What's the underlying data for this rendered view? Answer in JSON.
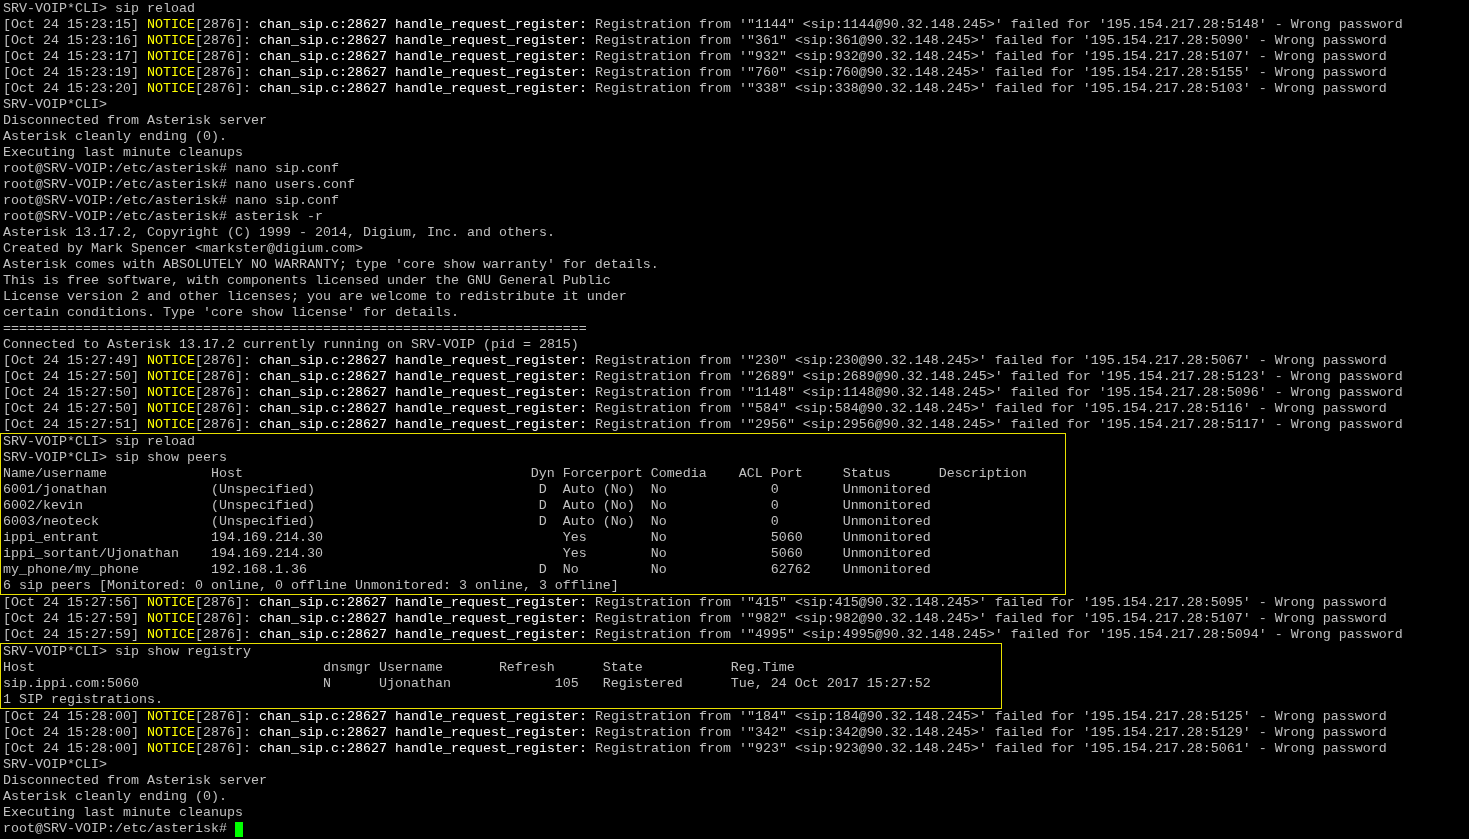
{
  "sections": [
    {
      "kind": "log",
      "lines": [
        {
          "kind": "output",
          "text": "SRV-VOIP*CLI> sip reload"
        },
        {
          "kind": "notice",
          "time": "[Oct 24 15:23:15]",
          "level": "NOTICE",
          "pid": "[2876]:",
          "source": "chan_sip.c:28627 handle_request_register:",
          "message": "Registration from '\"1144\" <sip:1144@90.32.148.245>' failed for '195.154.217.28:5148' - Wrong password"
        },
        {
          "kind": "notice",
          "time": "[Oct 24 15:23:16]",
          "level": "NOTICE",
          "pid": "[2876]:",
          "source": "chan_sip.c:28627 handle_request_register:",
          "message": "Registration from '\"361\" <sip:361@90.32.148.245>' failed for '195.154.217.28:5090' - Wrong password"
        },
        {
          "kind": "notice",
          "time": "[Oct 24 15:23:17]",
          "level": "NOTICE",
          "pid": "[2876]:",
          "source": "chan_sip.c:28627 handle_request_register:",
          "message": "Registration from '\"932\" <sip:932@90.32.148.245>' failed for '195.154.217.28:5107' - Wrong password"
        },
        {
          "kind": "notice",
          "time": "[Oct 24 15:23:19]",
          "level": "NOTICE",
          "pid": "[2876]:",
          "source": "chan_sip.c:28627 handle_request_register:",
          "message": "Registration from '\"760\" <sip:760@90.32.148.245>' failed for '195.154.217.28:5155' - Wrong password"
        },
        {
          "kind": "notice",
          "time": "[Oct 24 15:23:20]",
          "level": "NOTICE",
          "pid": "[2876]:",
          "source": "chan_sip.c:28627 handle_request_register:",
          "message": "Registration from '\"338\" <sip:338@90.32.148.245>' failed for '195.154.217.28:5103' - Wrong password"
        },
        {
          "kind": "output",
          "text": "SRV-VOIP*CLI>"
        },
        {
          "kind": "output",
          "text": "Disconnected from Asterisk server"
        },
        {
          "kind": "output",
          "text": "Asterisk cleanly ending (0)."
        },
        {
          "kind": "output",
          "text": "Executing last minute cleanups"
        },
        {
          "kind": "output",
          "text": "root@SRV-VOIP:/etc/asterisk# nano sip.conf"
        },
        {
          "kind": "output",
          "text": "root@SRV-VOIP:/etc/asterisk# nano users.conf"
        },
        {
          "kind": "output",
          "text": "root@SRV-VOIP:/etc/asterisk# nano sip.conf"
        },
        {
          "kind": "output",
          "text": "root@SRV-VOIP:/etc/asterisk# asterisk -r"
        },
        {
          "kind": "output",
          "text": "Asterisk 13.17.2, Copyright (C) 1999 - 2014, Digium, Inc. and others."
        },
        {
          "kind": "output",
          "text": "Created by Mark Spencer <markster@digium.com>"
        },
        {
          "kind": "output",
          "text": "Asterisk comes with ABSOLUTELY NO WARRANTY; type 'core show warranty' for details."
        },
        {
          "kind": "output",
          "text": "This is free software, with components licensed under the GNU General Public"
        },
        {
          "kind": "output",
          "text": "License version 2 and other licenses; you are welcome to redistribute it under"
        },
        {
          "kind": "output",
          "text": "certain conditions. Type 'core show license' for details."
        },
        {
          "kind": "output",
          "text": "========================================================================="
        },
        {
          "kind": "output",
          "text": "Connected to Asterisk 13.17.2 currently running on SRV-VOIP (pid = 2815)"
        },
        {
          "kind": "notice",
          "time": "[Oct 24 15:27:49]",
          "level": "NOTICE",
          "pid": "[2876]:",
          "source": "chan_sip.c:28627 handle_request_register:",
          "message": "Registration from '\"230\" <sip:230@90.32.148.245>' failed for '195.154.217.28:5067' - Wrong password"
        },
        {
          "kind": "notice",
          "time": "[Oct 24 15:27:50]",
          "level": "NOTICE",
          "pid": "[2876]:",
          "source": "chan_sip.c:28627 handle_request_register:",
          "message": "Registration from '\"2689\" <sip:2689@90.32.148.245>' failed for '195.154.217.28:5123' - Wrong password"
        },
        {
          "kind": "notice",
          "time": "[Oct 24 15:27:50]",
          "level": "NOTICE",
          "pid": "[2876]:",
          "source": "chan_sip.c:28627 handle_request_register:",
          "message": "Registration from '\"1148\" <sip:1148@90.32.148.245>' failed for '195.154.217.28:5096' - Wrong password"
        },
        {
          "kind": "notice",
          "time": "[Oct 24 15:27:50]",
          "level": "NOTICE",
          "pid": "[2876]:",
          "source": "chan_sip.c:28627 handle_request_register:",
          "message": "Registration from '\"584\" <sip:584@90.32.148.245>' failed for '195.154.217.28:5116' - Wrong password"
        },
        {
          "kind": "notice",
          "time": "[Oct 24 15:27:51]",
          "level": "NOTICE",
          "pid": "[2876]:",
          "source": "chan_sip.c:28627 handle_request_register:",
          "message": "Registration from '\"2956\" <sip:2956@90.32.148.245>' failed for '195.154.217.28:5117' - Wrong password"
        }
      ]
    },
    {
      "kind": "peers",
      "lines": [
        {
          "kind": "output",
          "text": "SRV-VOIP*CLI> sip reload"
        },
        {
          "kind": "output",
          "text": "SRV-VOIP*CLI> sip show peers"
        }
      ],
      "table": {
        "columns": [
          "Name/username",
          "Host",
          "Dyn",
          "Forcerport",
          "Comedia",
          "ACL",
          "Port",
          "Status",
          "Description"
        ],
        "rows": [
          {
            "name": "6001/jonathan",
            "host": "(Unspecified)",
            "dyn": "D",
            "forcerport": "Auto (No)",
            "comedia": "No",
            "port": "0",
            "status": "Unmonitored"
          },
          {
            "name": "6002/kevin",
            "host": "(Unspecified)",
            "dyn": "D",
            "forcerport": "Auto (No)",
            "comedia": "No",
            "port": "0",
            "status": "Unmonitored"
          },
          {
            "name": "6003/neoteck",
            "host": "(Unspecified)",
            "dyn": "D",
            "forcerport": "Auto (No)",
            "comedia": "No",
            "port": "0",
            "status": "Unmonitored"
          },
          {
            "name": "ippi_entrant",
            "host": "194.169.214.30",
            "forcerport": "Yes",
            "comedia": "No",
            "port": "5060",
            "status": "Unmonitored"
          },
          {
            "name": "ippi_sortant/Ujonathan",
            "host": "194.169.214.30",
            "forcerport": "Yes",
            "comedia": "No",
            "port": "5060",
            "status": "Unmonitored"
          },
          {
            "name": "my_phone/my_phone",
            "host": "192.168.1.36",
            "dyn": "D",
            "forcerport": "No",
            "comedia": "No",
            "port": "62762",
            "status": "Unmonitored"
          }
        ]
      },
      "summary": "6 sip peers [Monitored: 0 online, 0 offline Unmonitored: 3 online, 3 offline]"
    },
    {
      "kind": "log",
      "lines": [
        {
          "kind": "notice",
          "time": "[Oct 24 15:27:56]",
          "level": "NOTICE",
          "pid": "[2876]:",
          "source": "chan_sip.c:28627 handle_request_register:",
          "message": "Registration from '\"415\" <sip:415@90.32.148.245>' failed for '195.154.217.28:5095' - Wrong password"
        },
        {
          "kind": "notice",
          "time": "[Oct 24 15:27:59]",
          "level": "NOTICE",
          "pid": "[2876]:",
          "source": "chan_sip.c:28627 handle_request_register:",
          "message": "Registration from '\"982\" <sip:982@90.32.148.245>' failed for '195.154.217.28:5107' - Wrong password"
        },
        {
          "kind": "notice",
          "time": "[Oct 24 15:27:59]",
          "level": "NOTICE",
          "pid": "[2876]:",
          "source": "chan_sip.c:28627 handle_request_register:",
          "message": "Registration from '\"4995\" <sip:4995@90.32.148.245>' failed for '195.154.217.28:5094' - Wrong password"
        }
      ]
    },
    {
      "kind": "registry",
      "lines": [
        {
          "kind": "output",
          "text": "SRV-VOIP*CLI> sip show registry"
        }
      ],
      "table": {
        "columns": [
          "Host",
          "dnsmgr",
          "Username",
          "Refresh",
          "State",
          "Reg.Time"
        ],
        "rows": [
          {
            "host": "sip.ippi.com:5060",
            "dnsmgr": "N",
            "username": "Ujonathan",
            "refresh": "105",
            "state": "Registered",
            "regtime": "Tue, 24 Oct 2017 15:27:52"
          }
        ]
      },
      "summary": "1 SIP registrations."
    },
    {
      "kind": "log",
      "lines": [
        {
          "kind": "notice",
          "time": "[Oct 24 15:28:00]",
          "level": "NOTICE",
          "pid": "[2876]:",
          "source": "chan_sip.c:28627 handle_request_register:",
          "message": "Registration from '\"184\" <sip:184@90.32.148.245>' failed for '195.154.217.28:5125' - Wrong password"
        },
        {
          "kind": "notice",
          "time": "[Oct 24 15:28:00]",
          "level": "NOTICE",
          "pid": "[2876]:",
          "source": "chan_sip.c:28627 handle_request_register:",
          "message": "Registration from '\"342\" <sip:342@90.32.148.245>' failed for '195.154.217.28:5129' - Wrong password"
        },
        {
          "kind": "notice",
          "time": "[Oct 24 15:28:00]",
          "level": "NOTICE",
          "pid": "[2876]:",
          "source": "chan_sip.c:28627 handle_request_register:",
          "message": "Registration from '\"923\" <sip:923@90.32.148.245>' failed for '195.154.217.28:5061' - Wrong password"
        },
        {
          "kind": "output",
          "text": "SRV-VOIP*CLI>"
        },
        {
          "kind": "output",
          "text": "Disconnected from Asterisk server"
        },
        {
          "kind": "output",
          "text": "Asterisk cleanly ending (0)."
        },
        {
          "kind": "output",
          "text": "Executing last minute cleanups"
        },
        {
          "kind": "output",
          "text": "root@SRV-VOIP:/etc/asterisk#",
          "cursor": true
        }
      ]
    }
  ]
}
